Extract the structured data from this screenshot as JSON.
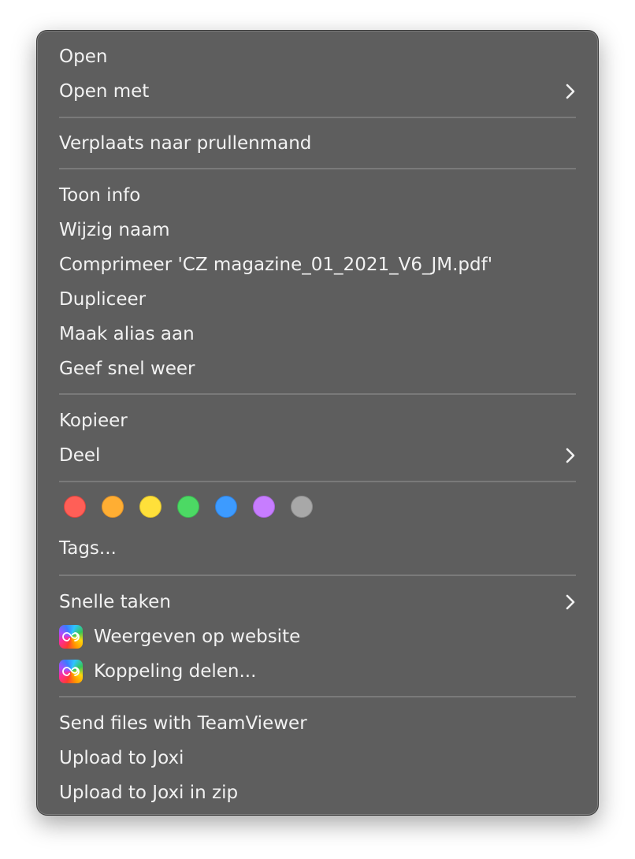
{
  "menu": {
    "open": "Open",
    "open_with": "Open met",
    "trash": "Verplaats naar prullenmand",
    "get_info": "Toon info",
    "rename": "Wijzig naam",
    "compress": "Comprimeer 'CZ magazine_01_2021_V6_JM.pdf'",
    "duplicate": "Dupliceer",
    "make_alias": "Maak alias aan",
    "quick_look": "Geef snel weer",
    "copy": "Kopieer",
    "share": "Deel",
    "tags": "Tags...",
    "quick_actions": "Snelle taken",
    "view_on_website": "Weergeven op website",
    "share_link": "Koppeling delen...",
    "teamviewer": "Send files with TeamViewer",
    "upload_joxi": "Upload to Joxi",
    "upload_joxi_zip": "Upload to Joxi in zip"
  },
  "tag_colors": [
    {
      "name": "red",
      "fill": "#ff5f57",
      "border": "#e0443e"
    },
    {
      "name": "orange",
      "fill": "#ffae33",
      "border": "#e0922a"
    },
    {
      "name": "yellow",
      "fill": "#ffe03a",
      "border": "#dcc02c"
    },
    {
      "name": "green",
      "fill": "#4cd964",
      "border": "#3cb852"
    },
    {
      "name": "blue",
      "fill": "#3d9bff",
      "border": "#2f80dd"
    },
    {
      "name": "purple",
      "fill": "#c77dff",
      "border": "#a965dd"
    },
    {
      "name": "gray",
      "fill": "#a8a8a8",
      "border": "#8c8c8c"
    }
  ],
  "icons": {
    "submenu": "chevron-right-icon",
    "creative_cloud": "creative-cloud-icon"
  }
}
